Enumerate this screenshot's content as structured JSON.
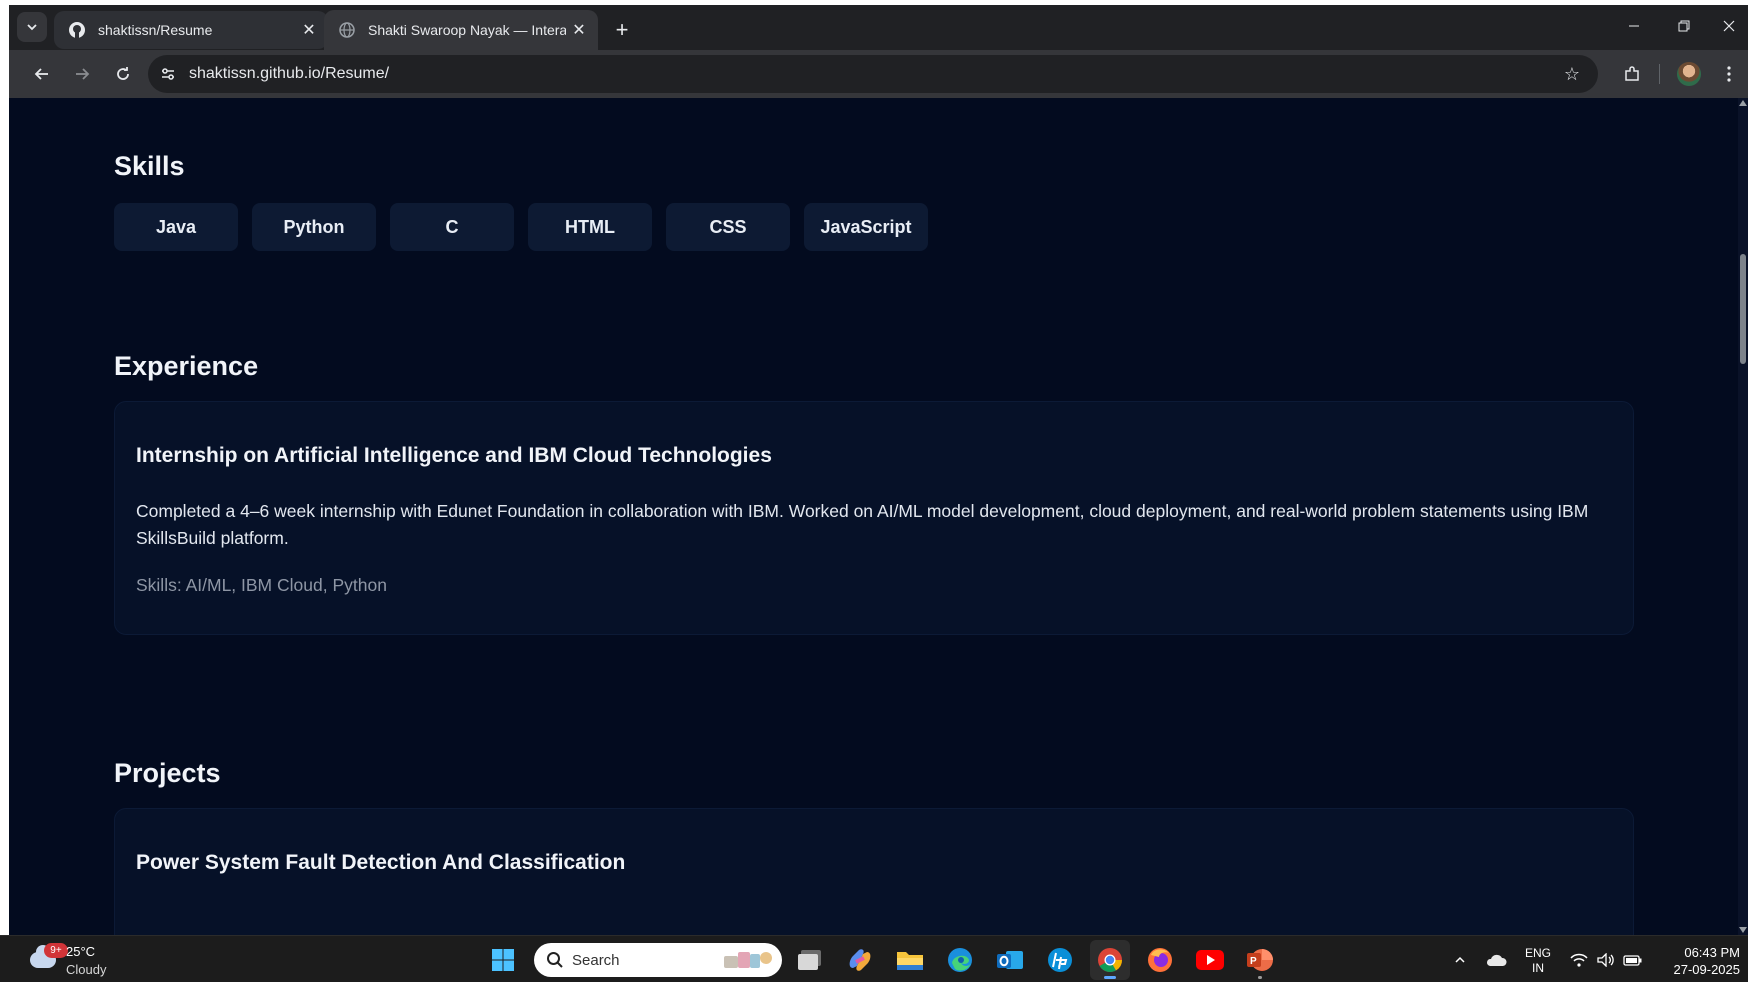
{
  "browser": {
    "tabs": [
      {
        "title": "shaktissn/Resume",
        "favicon": "github-icon",
        "active": false
      },
      {
        "title": "Shakti Swaroop Nayak — Intera",
        "favicon": "globe-icon",
        "active": true
      }
    ],
    "address_bar": {
      "url": "shaktissn.github.io/Resume/"
    }
  },
  "page": {
    "skills": {
      "heading": "Skills",
      "items": [
        "Java",
        "Python",
        "C",
        "HTML",
        "CSS",
        "JavaScript"
      ]
    },
    "experience": {
      "heading": "Experience",
      "items": [
        {
          "title": "Internship on Artificial Intelligence and IBM Cloud Technologies",
          "description": "Completed a 4–6 week internship with Edunet Foundation in collaboration with IBM. Worked on AI/ML model development, cloud deployment, and real-world problem statements using IBM SkillsBuild platform.",
          "skills": "Skills: AI/ML, IBM Cloud, Python"
        }
      ]
    },
    "projects": {
      "heading": "Projects",
      "items": [
        {
          "title": "Power System Fault Detection And Classification"
        }
      ]
    }
  },
  "taskbar": {
    "weather": {
      "temperature": "25°C",
      "condition": "Cloudy",
      "badge": "9+"
    },
    "search_placeholder": "Search",
    "apps": [
      "start-icon",
      "search",
      "task-view-icon",
      "copilot-icon",
      "file-explorer-icon",
      "edge-icon",
      "outlook-icon",
      "hp-icon",
      "chrome-icon",
      "firefox-icon",
      "youtube-icon",
      "powerpoint-icon"
    ],
    "language": {
      "line1": "ENG",
      "line2": "IN"
    },
    "clock": {
      "time": "06:43 PM",
      "date": "27-09-2025"
    }
  },
  "colors": {
    "page_background": "#030b1f",
    "card_background": "#061128",
    "chip_background": "#0d1a33",
    "browser_chrome": "#202124",
    "toolbar": "#35363a",
    "taskbar": "#1c1c1c"
  }
}
